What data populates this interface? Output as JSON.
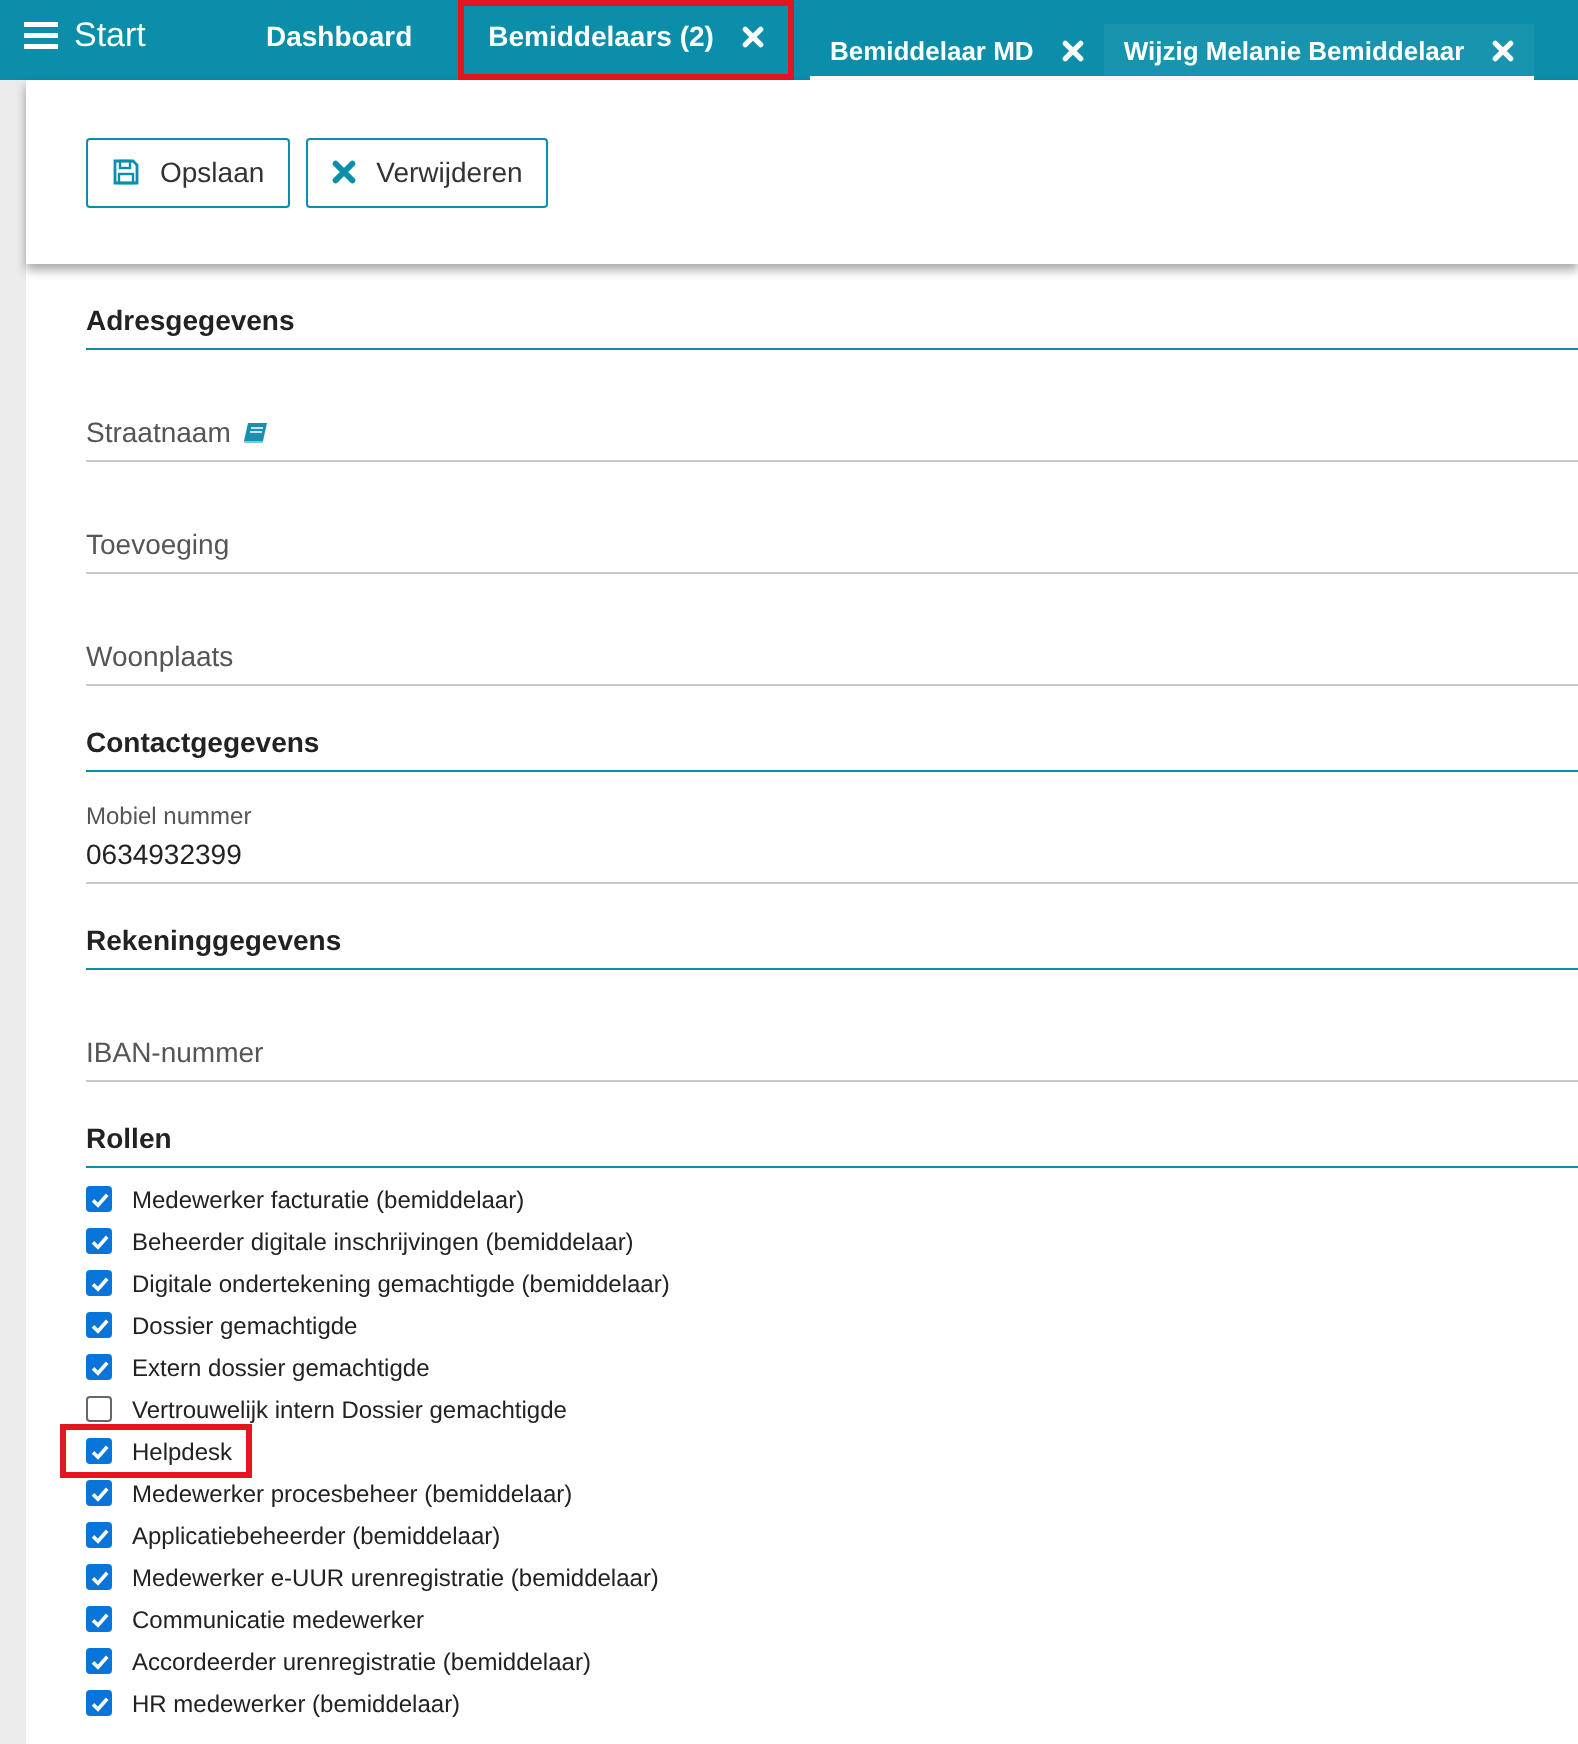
{
  "topbar": {
    "menu_label": "Start"
  },
  "tabs": [
    {
      "label": "Dashboard",
      "kind": "main",
      "closable": false,
      "selected": false,
      "highlighted": false
    },
    {
      "label": "Bemiddelaars (2)",
      "kind": "main",
      "closable": true,
      "selected": false,
      "highlighted": true
    },
    {
      "label": "Bemiddelaar MD",
      "kind": "sub",
      "closable": true,
      "selected": false,
      "highlighted": false
    },
    {
      "label": "Wijzig Melanie Bemiddelaar",
      "kind": "sub",
      "closable": true,
      "selected": true,
      "highlighted": false
    }
  ],
  "toolbar": {
    "buttons": [
      {
        "label": "Opslaan",
        "kind": "save"
      },
      {
        "label": "Verwijderen",
        "kind": "delete"
      }
    ]
  },
  "sections": [
    {
      "title": "Adresgegevens",
      "fields": [
        {
          "kind": "empty",
          "placeholder": "Straatnaam",
          "lookup": true
        },
        {
          "kind": "empty",
          "placeholder": "Toevoeging",
          "lookup": false
        },
        {
          "kind": "empty",
          "placeholder": "Woonplaats",
          "lookup": false
        }
      ]
    },
    {
      "title": "Contactgegevens",
      "fields": [
        {
          "kind": "filled",
          "label": "Mobiel nummer",
          "value": "0634932399",
          "lookup": false
        }
      ]
    },
    {
      "title": "Rekeninggegevens",
      "fields": [
        {
          "kind": "empty",
          "placeholder": "IBAN-nummer",
          "lookup": false
        }
      ]
    },
    {
      "title": "Rollen",
      "roles": [
        {
          "label": "Medewerker facturatie (bemiddelaar)",
          "checked": true,
          "highlighted": false
        },
        {
          "label": "Beheerder digitale inschrijvingen (bemiddelaar)",
          "checked": true,
          "highlighted": false
        },
        {
          "label": "Digitale ondertekening gemachtigde (bemiddelaar)",
          "checked": true,
          "highlighted": false
        },
        {
          "label": "Dossier gemachtigde",
          "checked": true,
          "highlighted": false
        },
        {
          "label": "Extern dossier gemachtigde",
          "checked": true,
          "highlighted": false
        },
        {
          "label": "Vertrouwelijk intern Dossier gemachtigde",
          "checked": false,
          "highlighted": false
        },
        {
          "label": "Helpdesk",
          "checked": true,
          "highlighted": true
        },
        {
          "label": "Medewerker procesbeheer (bemiddelaar)",
          "checked": true,
          "highlighted": false
        },
        {
          "label": "Applicatiebeheerder (bemiddelaar)",
          "checked": true,
          "highlighted": false
        },
        {
          "label": "Medewerker e-UUR urenregistratie (bemiddelaar)",
          "checked": true,
          "highlighted": false
        },
        {
          "label": "Communicatie medewerker",
          "checked": true,
          "highlighted": false
        },
        {
          "label": "Accordeerder urenregistratie (bemiddelaar)",
          "checked": true,
          "highlighted": false
        },
        {
          "label": "HR medewerker (bemiddelaar)",
          "checked": true,
          "highlighted": false
        }
      ]
    }
  ]
}
